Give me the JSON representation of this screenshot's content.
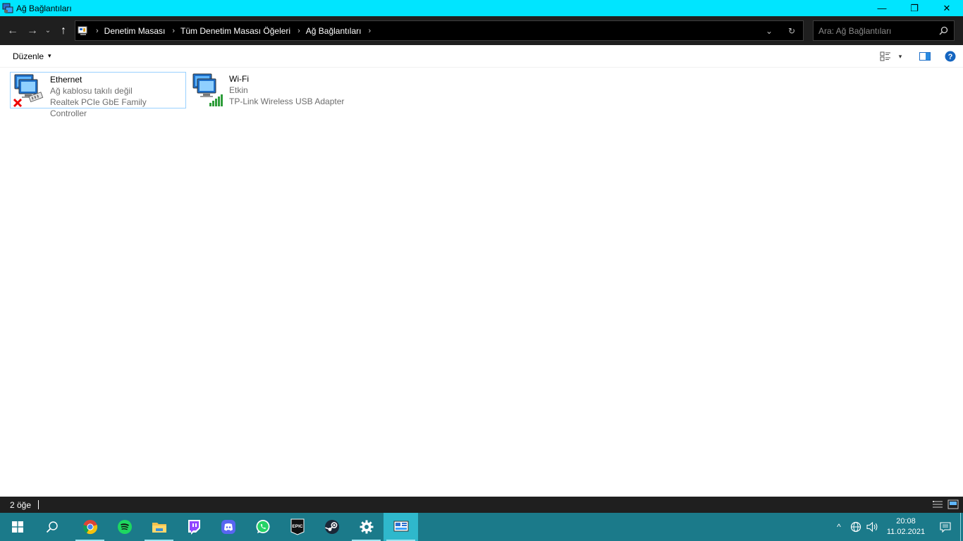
{
  "window": {
    "title": "Ağ Bağlantıları",
    "minimize_icon": "—",
    "restore_icon": "❐",
    "close_icon": "✕"
  },
  "nav": {
    "back_icon": "←",
    "forward_icon": "→",
    "recent_icon": "⌄",
    "up_icon": "↑",
    "breadcrumb": [
      "Denetim Masası",
      "Tüm Denetim Masası Öğeleri",
      "Ağ Bağlantıları"
    ],
    "crumb_sep": "›",
    "dropdown_icon": "⌄",
    "refresh_icon": "↻"
  },
  "search": {
    "placeholder": "Ara: Ağ Bağlantıları"
  },
  "toolbar": {
    "organize_label": "Düzenle",
    "caret": "▾",
    "view_caret": "▾"
  },
  "connections": [
    {
      "name": "Ethernet",
      "status": "Ağ kablosu takılı değil",
      "device": "Realtek PCIe GbE Family Controller",
      "selected": true
    },
    {
      "name": "Wi-Fi",
      "status": "Etkin",
      "device": "TP-Link Wireless USB Adapter",
      "selected": false
    }
  ],
  "statusbar": {
    "item_count": "2 öğe"
  },
  "taskbar": {
    "apps": [
      "start",
      "search",
      "chrome",
      "spotify",
      "file-explorer",
      "twitch",
      "discord",
      "whatsapp",
      "epic-games",
      "steam",
      "settings",
      "network-connections"
    ],
    "epic_label": "EPIC",
    "tray_chevron": "^",
    "time": "20:08",
    "date": "11.02.2021"
  },
  "colors": {
    "titlebar": "#00e5ff",
    "taskbar": "#1b7a8a",
    "selection_border": "#99d1ff",
    "dark_chrome": "#1f1f1f"
  }
}
